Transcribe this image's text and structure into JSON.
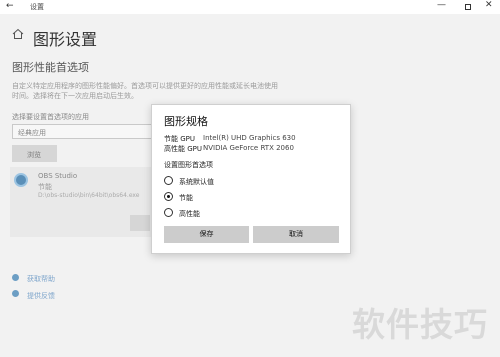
{
  "window": {
    "title": "设置",
    "back_glyph": "←",
    "minimize_glyph": "—",
    "close_glyph": "✕"
  },
  "page": {
    "title": "图形设置",
    "section_title": "图形性能首选项",
    "description": "自定义特定应用程序的图形性能偏好。首选项可以提供更好的应用性能或延长电池使用时间。选择将在下一次应用启动后生效。",
    "select_label": "选择要设置首选项的应用",
    "select_value": "经典应用",
    "browse_label": "浏览",
    "app": {
      "name": "OBS Studio",
      "preference": "节能",
      "path": "D:\\obs-studio\\bin\\64bit\\obs64.exe"
    },
    "links": [
      "获取帮助",
      "提供反馈"
    ]
  },
  "dialog": {
    "title": "图形规格",
    "gpus": [
      {
        "key": "节能 GPU",
        "value": "Intel(R) UHD Graphics 630"
      },
      {
        "key": "高性能 GPU",
        "value": "NVIDIA GeForce RTX 2060"
      }
    ],
    "pref_label": "设置图形首选项",
    "options": [
      {
        "label": "系统默认值",
        "checked": false
      },
      {
        "label": "节能",
        "checked": true
      },
      {
        "label": "高性能",
        "checked": false
      }
    ],
    "save_label": "保存",
    "cancel_label": "取消"
  },
  "watermark": "软件技巧"
}
